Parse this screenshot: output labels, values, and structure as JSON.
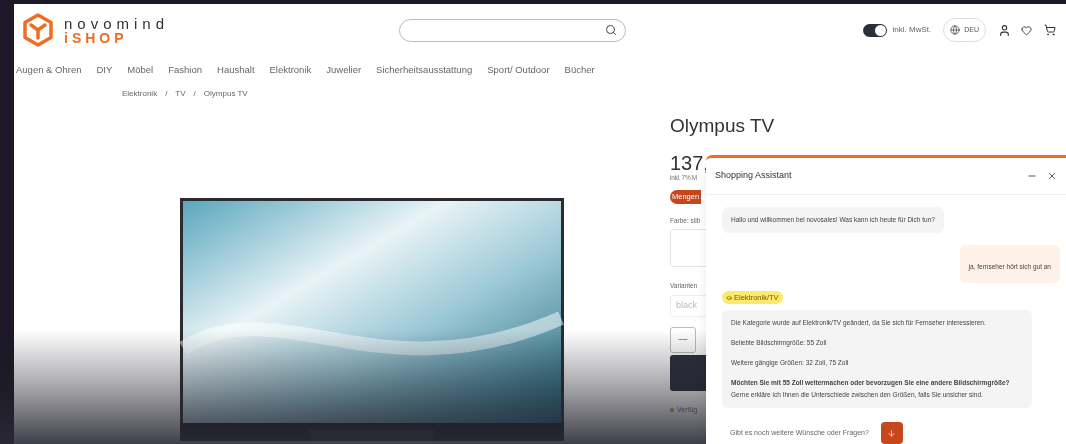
{
  "header": {
    "logo_line1": "novomind",
    "logo_line2": "iSHOP",
    "tax_toggle": {
      "label": "inkl. MwSt.",
      "on": true
    },
    "language": "DEU"
  },
  "nav": [
    "Augen & Ohren",
    "DIY",
    "Möbel",
    "Fashion",
    "Haushalt",
    "Elektronik",
    "Juwelier",
    "Sicherheitsausstattung",
    "Sport/ Outdoor",
    "Bücher"
  ],
  "breadcrumb": [
    "Elektronik",
    "/",
    "TV",
    "/",
    "Olympus TV"
  ],
  "product": {
    "title": "Olympus TV",
    "price": "137,",
    "tax_note": "inkl. 7% M",
    "badge": "Mengen",
    "color_label": "Farbe: silb",
    "variants_label": "Varianten",
    "variant_value": "black",
    "qty_minus": "—",
    "availability": "Verfüg"
  },
  "chat": {
    "title": "Shopping Assistant",
    "messages": [
      {
        "kind": "bot",
        "paragraphs": [
          "Hallo und willkommen bei novosales! Was kann ich heute für Dich tun?"
        ]
      },
      {
        "kind": "user",
        "paragraphs": [
          "ja, fernseher hört sich gut an"
        ]
      },
      {
        "kind": "tag",
        "paragraphs": [
          "Elektronik/TV"
        ]
      },
      {
        "kind": "bot",
        "paragraphs": [
          "Die Kategorie wurde auf Elektronik/TV geändert, da Sie sich für Fernseher interessieren.",
          "Beliebte Bildschirmgröße: 55 Zoll",
          "Weitere gängige Größen: 32 Zoll, 75 Zoll",
          "**Möchten Sie mit 55 Zoll weitermachen oder bevorzugen Sie eine andere Bildschirmgröße?** Gerne erkläre ich Ihnen die Unterschiede zwischen den Größen, falls Sie unsicher sind."
        ]
      }
    ],
    "input_placeholder": "Gibt es noch weitere Wünsche oder Fragen?"
  }
}
